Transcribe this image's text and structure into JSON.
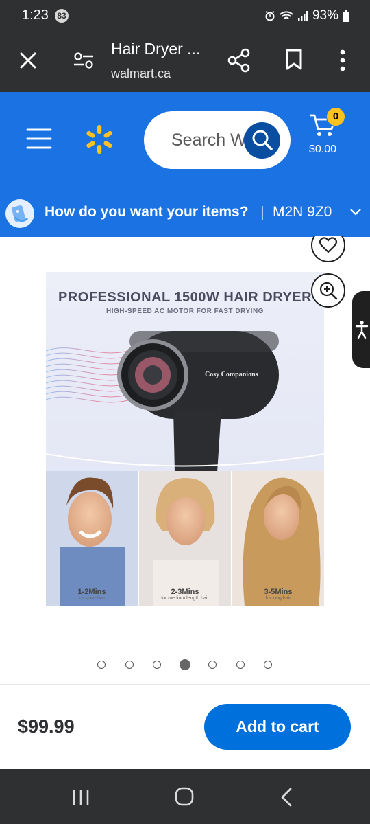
{
  "status_bar": {
    "time": "1:23",
    "notification_count": "83",
    "battery": "93%"
  },
  "browser": {
    "title": "Hair Dryer ...",
    "url": "walmart.ca"
  },
  "header": {
    "search_placeholder": "Search Walmart",
    "cart_count": "0",
    "cart_total": "$0.00",
    "brand_color": "#1a72e3",
    "spark_color": "#ffc220"
  },
  "delivery": {
    "question": "How do you want your items?",
    "separator": "|",
    "postal_code": "M2N 9Z0"
  },
  "product_image": {
    "headline": "PROFESSIONAL 1500W HAIR DRYER",
    "subheadline": "HIGH-SPEED AC MOTOR FOR FAST DRYING",
    "brand_text": "Cosy Companions",
    "panels": [
      {
        "time": "1-2Mins",
        "desc": "for short hair"
      },
      {
        "time": "2-3Mins",
        "desc": "for medium length hair"
      },
      {
        "time": "3-5Mins",
        "desc": "for long hair"
      }
    ]
  },
  "carousel": {
    "total": 7,
    "active_index": 3
  },
  "buy_bar": {
    "price": "$99.99",
    "add_to_cart_label": "Add to cart",
    "button_color": "#0071dc"
  }
}
